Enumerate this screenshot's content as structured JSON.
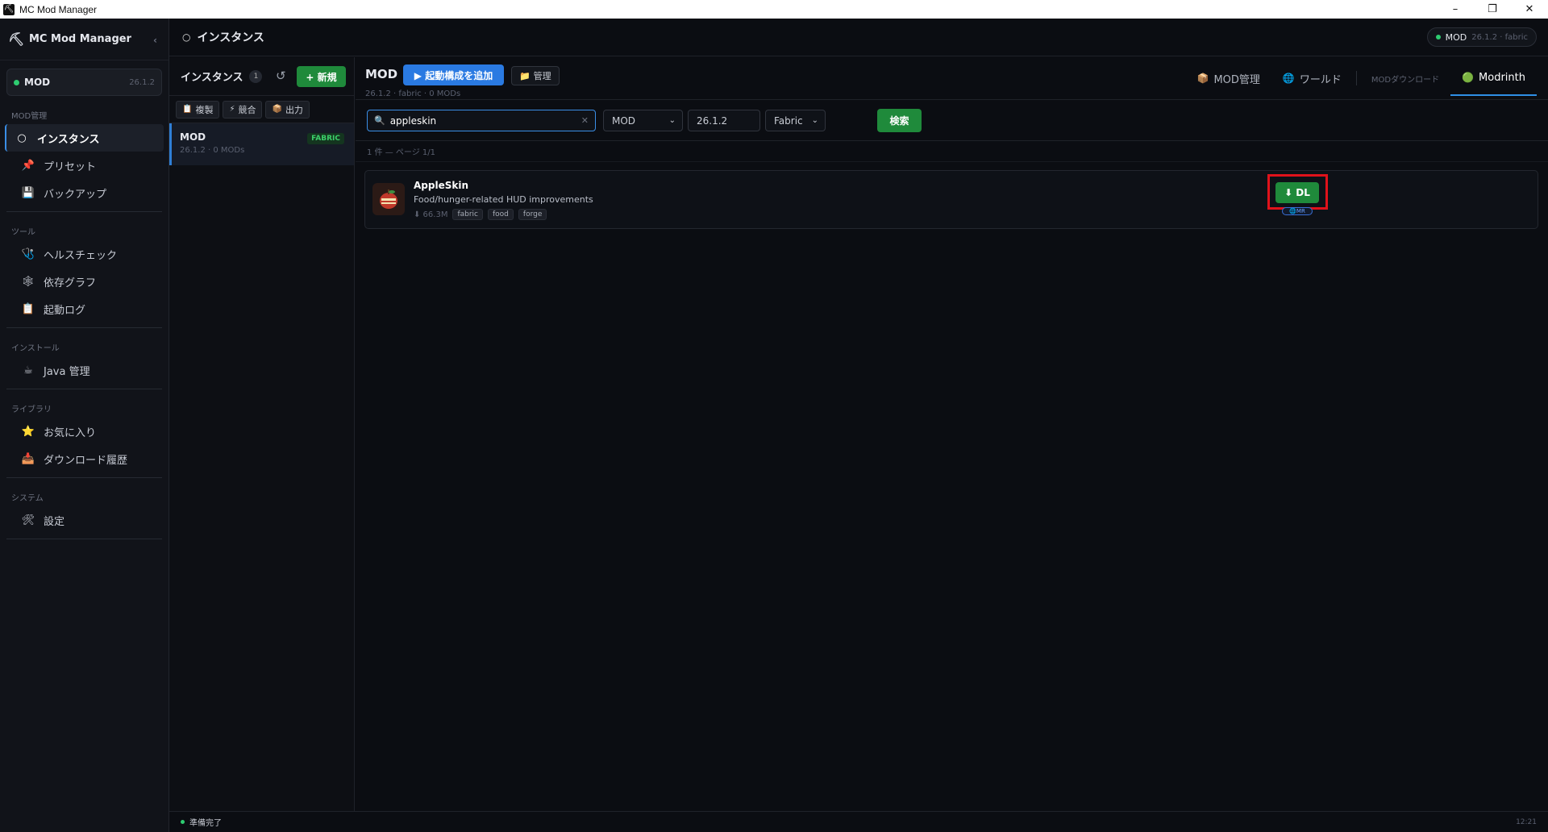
{
  "window": {
    "title": "MC Mod Manager",
    "minimize": "–",
    "restore": "❐",
    "close": "✕"
  },
  "sidebar": {
    "brand": "MC Mod Manager",
    "collapse": "‹",
    "instance": {
      "name": "MOD",
      "version": "26.1.2"
    },
    "sections": [
      {
        "title": "MOD管理",
        "items": [
          {
            "icon": "○",
            "label": "インスタンス",
            "active": true
          },
          {
            "icon": "📌",
            "label": "プリセット"
          },
          {
            "icon": "💾",
            "label": "バックアップ"
          }
        ]
      },
      {
        "title": "ツール",
        "items": [
          {
            "icon": "🩺",
            "label": "ヘルスチェック"
          },
          {
            "icon": "🕸",
            "label": "依存グラフ"
          },
          {
            "icon": "📋",
            "label": "起動ログ"
          }
        ]
      },
      {
        "title": "インストール",
        "items": [
          {
            "icon": "☕",
            "label": "Java 管理"
          }
        ]
      },
      {
        "title": "ライブラリ",
        "items": [
          {
            "icon": "⭐",
            "label": "お気に入り"
          },
          {
            "icon": "📥",
            "label": "ダウンロード履歴"
          }
        ]
      },
      {
        "title": "システム",
        "items": [
          {
            "icon": "🛠",
            "label": "設定"
          }
        ]
      }
    ]
  },
  "header": {
    "icon": "○",
    "title": "インスタンス",
    "pill": {
      "name": "MOD",
      "sub": "26.1.2 · fabric"
    }
  },
  "instances": {
    "title": "インスタンス",
    "count": "1",
    "refresh": "↺",
    "new_label": "+ 新規",
    "actions": [
      {
        "icon": "📋",
        "label": "複製"
      },
      {
        "icon": "⚡",
        "label": "競合"
      },
      {
        "icon": "📦",
        "label": "出力"
      }
    ],
    "list": [
      {
        "name": "MOD",
        "meta": "26.1.2 · 0 MODs",
        "badge": "FABRIC"
      }
    ]
  },
  "main": {
    "title": "MOD",
    "subtitle": "26.1.2 · fabric · 0 MODs",
    "add_config": "▶ 起動構成を追加",
    "manage": "📁 管理",
    "tabs": [
      {
        "icon": "📦",
        "label": "MOD管理"
      },
      {
        "icon": "🌐",
        "label": "ワールド"
      },
      {
        "label": "MODダウンロード",
        "small": true
      },
      {
        "icon": "🟢",
        "label": "Modrinth",
        "active": true
      }
    ],
    "search": {
      "icon": "🔍",
      "value": "appleskin",
      "clear": "✕",
      "type": "MOD",
      "version": "26.1.2",
      "loader": "Fabric",
      "button": "検索"
    },
    "result_count": "1 件 — ページ 1/1",
    "results": [
      {
        "name": "AppleSkin",
        "description": "Food/hunger-related HUD improvements",
        "downloads": "⬇ 66.3M",
        "tags": [
          "fabric",
          "food",
          "forge"
        ],
        "dl_label": "⬇ DL",
        "source_badge": "🌐MR"
      }
    ]
  },
  "status": {
    "text": "準備完了",
    "time": "12:21"
  },
  "colors": {
    "accent_blue": "#2a7ae2",
    "accent_green": "#1f8a3b",
    "highlight_red": "#e0121b",
    "background": "#0b0d12"
  }
}
